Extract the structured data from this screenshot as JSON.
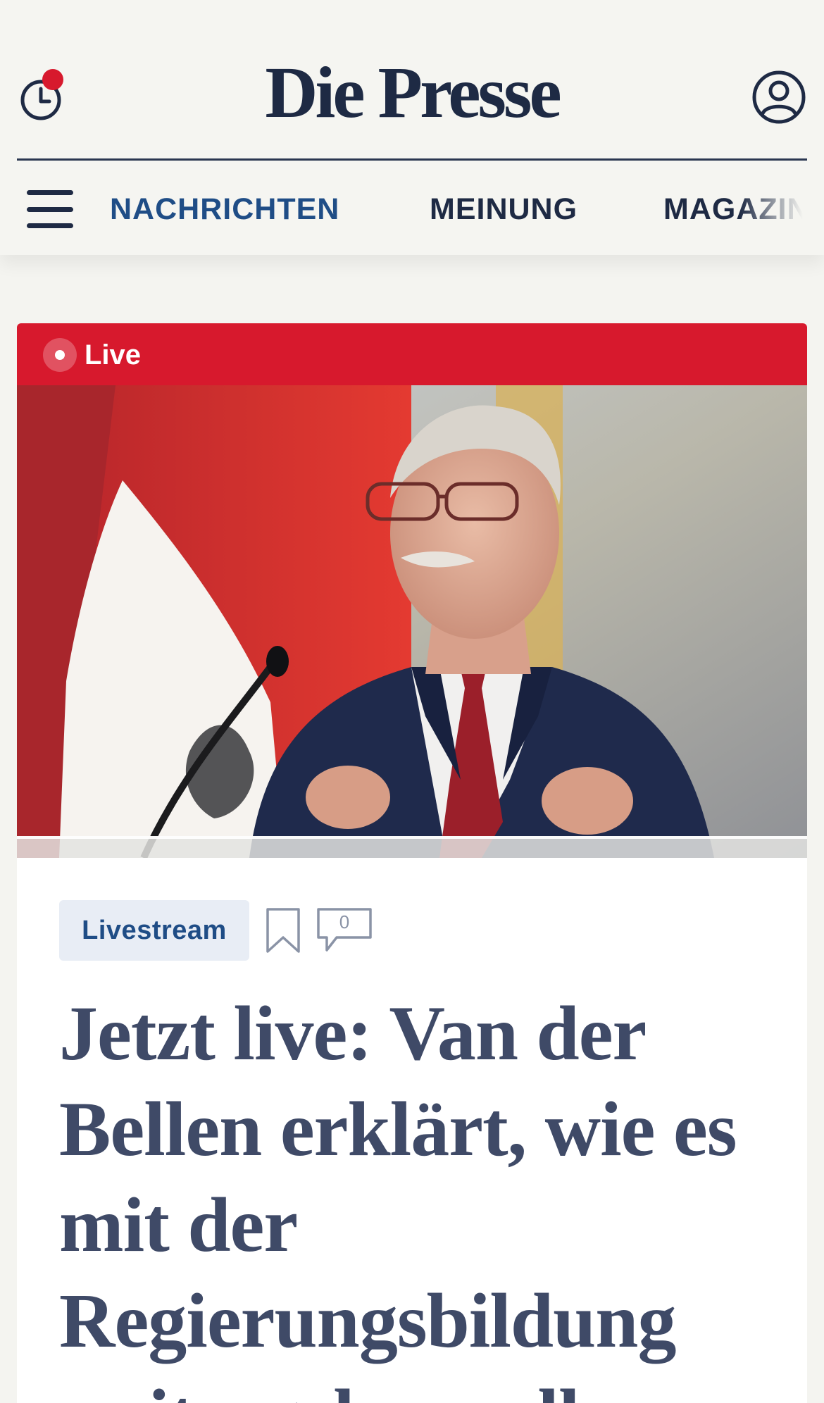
{
  "header": {
    "logo": "Die Presse",
    "history_icon": "history-clock-icon",
    "account_icon": "account-icon",
    "menu_icon": "menu-icon",
    "notification_dot": true
  },
  "nav": {
    "items": [
      {
        "label": "NACHRICHTEN",
        "active": true
      },
      {
        "label": "MEINUNG",
        "active": false
      },
      {
        "label": "MAGAZIN",
        "active": false
      }
    ]
  },
  "article": {
    "live_label": "Live",
    "image_description_icon": "article-photo",
    "tag": "Livestream",
    "bookmark_icon": "bookmark-icon",
    "comments_icon": "comment-icon",
    "comments_count": "0",
    "headline": "Jetzt live: Van der Bellen erklärt, wie es mit der Regierungsbildung weitergehen soll"
  },
  "colors": {
    "brand_navy": "#1e2a44",
    "nav_active": "#1f4d86",
    "live_red": "#d7192d",
    "tag_bg": "#e8edf5",
    "headline": "#3f4a67",
    "page_bg": "#f4f4f0"
  }
}
